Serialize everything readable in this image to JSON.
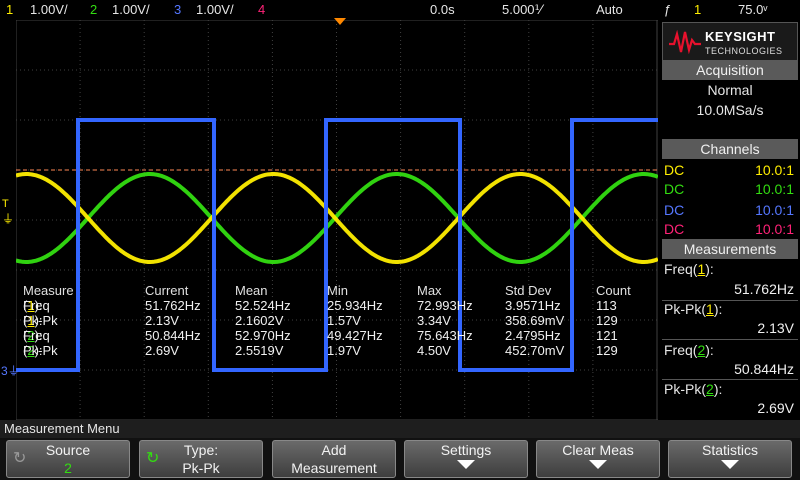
{
  "topbar": {
    "ch1_num": "1",
    "ch1_scale": "1.00V/",
    "ch2_num": "2",
    "ch2_scale": "1.00V/",
    "ch3_num": "3",
    "ch3_scale": "1.00V/",
    "ch4_num": "4",
    "time_delay": "0.0s",
    "time_scale": "5.000⅟",
    "trigger_mode": "Auto",
    "trigger_source": "1",
    "trigger_level": "75.0ᵛ"
  },
  "colors": {
    "ch1": "#ffee00",
    "ch2": "#33dd11",
    "ch3": "#3366ff",
    "ch4": "#ff2277",
    "trigger_line": "#ff8855",
    "grid": "#404040",
    "header": "#5a5a5a"
  },
  "waveforms": {
    "ch1": {
      "shape": "sine",
      "frequency_hz": 51.762,
      "pk_pk_v": 2.13
    },
    "ch2": {
      "shape": "sine",
      "frequency_hz": 50.844,
      "pk_pk_v": 2.69
    },
    "ch3": {
      "shape": "square",
      "period_div": 5.5
    }
  },
  "measurements_table": {
    "headers": [
      "Measure",
      "Current",
      "Mean",
      "Min",
      "Max",
      "Std Dev",
      "Count"
    ],
    "rows": [
      {
        "name": "Freq",
        "channel": "1",
        "current": "51.762Hz",
        "mean": "52.524Hz",
        "min": "25.934Hz",
        "max": "72.993Hz",
        "std_dev": "3.9571Hz",
        "count": "113"
      },
      {
        "name": "Pk-Pk",
        "channel": "1",
        "current": "2.13V",
        "mean": "2.1602V",
        "min": "1.57V",
        "max": "3.34V",
        "std_dev": "358.69mV",
        "count": "129"
      },
      {
        "name": "Freq",
        "channel": "2",
        "current": "50.844Hz",
        "mean": "52.970Hz",
        "min": "49.427Hz",
        "max": "75.643Hz",
        "std_dev": "2.4795Hz",
        "count": "121"
      },
      {
        "name": "Pk-Pk",
        "channel": "2",
        "current": "2.69V",
        "mean": "2.5519V",
        "min": "1.97V",
        "max": "4.50V",
        "std_dev": "452.70mV",
        "count": "129"
      }
    ]
  },
  "panel": {
    "brand": "KEYSIGHT",
    "brand_sub": "TECHNOLOGIES",
    "acquisition_header": "Acquisition",
    "acq_mode": "Normal",
    "acq_rate": "10.0MSa/s",
    "channels_header": "Channels",
    "channels": [
      {
        "coupling": "DC",
        "probe": "10.0:1"
      },
      {
        "coupling": "DC",
        "probe": "10.0:1"
      },
      {
        "coupling": "DC",
        "probe": "10.0:1"
      },
      {
        "coupling": "DC",
        "probe": "10.0:1"
      }
    ],
    "measurements_header": "Measurements",
    "measurements": [
      {
        "name": "Freq",
        "channel": "1",
        "value": "51.762Hz"
      },
      {
        "name": "Pk-Pk",
        "channel": "1",
        "value": "2.13V"
      },
      {
        "name": "Freq",
        "channel": "2",
        "value": "50.844Hz"
      },
      {
        "name": "Pk-Pk",
        "channel": "2",
        "value": "2.69V"
      }
    ]
  },
  "menu": {
    "title": "Measurement Menu",
    "source_label": "Source",
    "source_value": "2",
    "type_label": "Type:",
    "type_value": "Pk-Pk",
    "add_line1": "Add",
    "add_line2": "Measurement",
    "settings_label": "Settings",
    "clear_label": "Clear Meas",
    "statistics_label": "Statistics"
  }
}
